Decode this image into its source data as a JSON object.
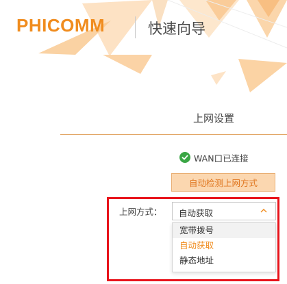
{
  "header": {
    "logo_text": "PHICOMM",
    "wizard_title": "快速向导"
  },
  "section": {
    "title": "上网设置"
  },
  "wan": {
    "status_text": "WAN口已连接"
  },
  "detect_button": {
    "label": "自动检测上网方式"
  },
  "connection_mode": {
    "label": "上网方式：",
    "selected_value": "自动获取",
    "options": [
      {
        "label": "宽带拨号",
        "state": "hovered"
      },
      {
        "label": "自动获取",
        "state": "selected"
      },
      {
        "label": "静态地址",
        "state": "normal"
      }
    ]
  },
  "colors": {
    "brand_orange": "#f08c1e",
    "success_green": "#3aa645",
    "highlight_red": "#e8131b",
    "button_bg": "#fbd7b0"
  },
  "icons": [
    "check-circle-icon",
    "chevron-up-icon"
  ]
}
